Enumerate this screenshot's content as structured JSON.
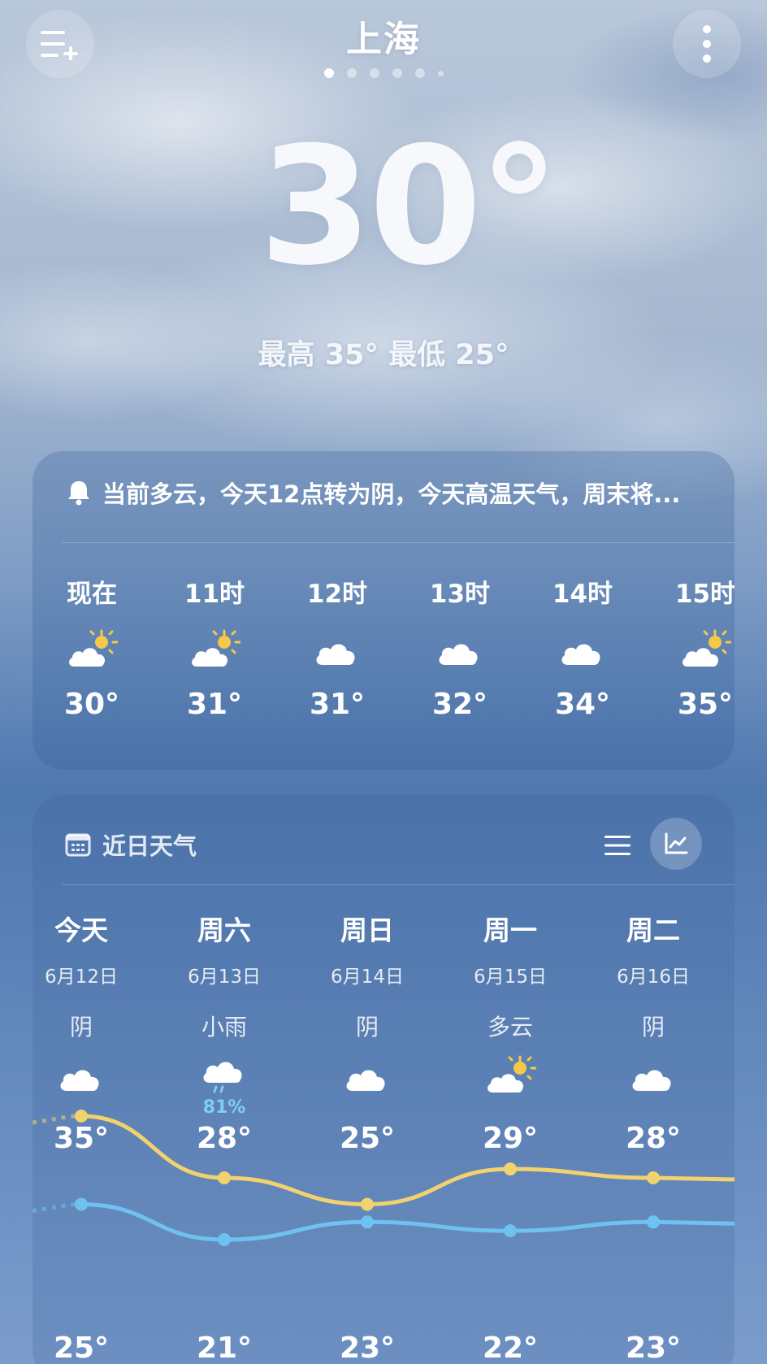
{
  "city": "上海",
  "current": {
    "temperature": "30°",
    "hilo": "最高 35° 最低 25°"
  },
  "alert": {
    "text": "当前多云，今天12点转为阴，今天高温天气，周末将..."
  },
  "hourly": [
    {
      "label": "现在",
      "icon": "partly-cloudy-icon",
      "temp": "30°"
    },
    {
      "label": "11时",
      "icon": "partly-cloudy-icon",
      "temp": "31°"
    },
    {
      "label": "12时",
      "icon": "cloudy-icon",
      "temp": "31°"
    },
    {
      "label": "13时",
      "icon": "cloudy-icon",
      "temp": "32°"
    },
    {
      "label": "14时",
      "icon": "cloudy-icon",
      "temp": "34°"
    },
    {
      "label": "15时",
      "icon": "partly-cloudy-icon",
      "temp": "35°"
    }
  ],
  "daily": {
    "title": "近日天气",
    "days": [
      {
        "name": "今天",
        "date": "6月12日",
        "cond": "阴",
        "icon": "cloudy-icon",
        "pop": "",
        "high": "35°",
        "low": "25°"
      },
      {
        "name": "周六",
        "date": "6月13日",
        "cond": "小雨",
        "icon": "light-rain-icon",
        "pop": "81%",
        "high": "28°",
        "low": "21°"
      },
      {
        "name": "周日",
        "date": "6月14日",
        "cond": "阴",
        "icon": "cloudy-icon",
        "pop": "",
        "high": "25°",
        "low": "23°"
      },
      {
        "name": "周一",
        "date": "6月15日",
        "cond": "多云",
        "icon": "partly-cloudy-icon",
        "pop": "",
        "high": "29°",
        "low": "22°"
      },
      {
        "name": "周二",
        "date": "6月16日",
        "cond": "阴",
        "icon": "cloudy-icon",
        "pop": "",
        "high": "28°",
        "low": "23°"
      }
    ]
  },
  "colors": {
    "high_line": "#f2d26e",
    "low_line": "#6ec2f0",
    "sun": "#f5c84a"
  }
}
